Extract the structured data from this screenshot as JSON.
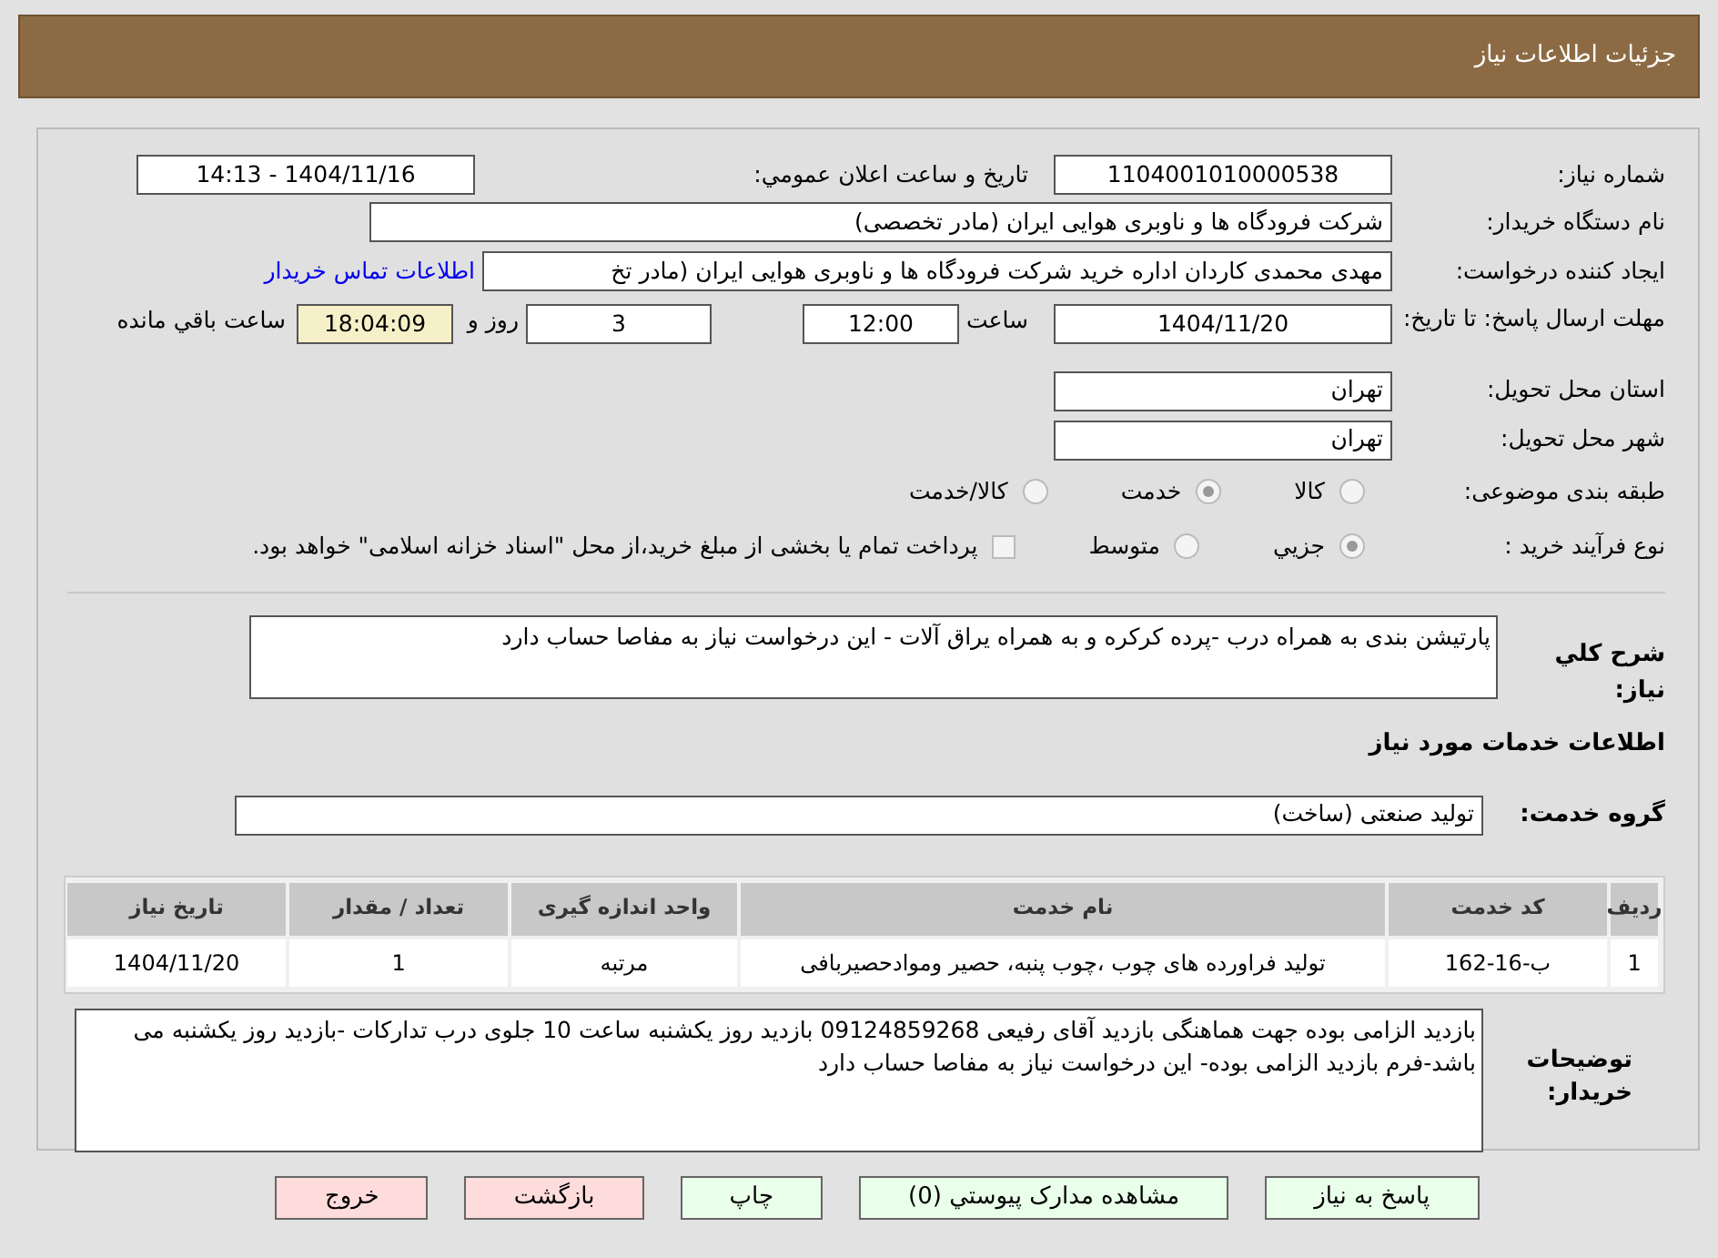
{
  "header": {
    "title": "جزئیات اطلاعات نیاز"
  },
  "need_number": {
    "label": "شماره نیاز:",
    "value": "1104001010000538"
  },
  "announce": {
    "label": "تاريخ و ساعت اعلان عمومي:",
    "value": "1404/11/16 - 14:13"
  },
  "buyer_org": {
    "label": "نام دستگاه خریدار:",
    "value": "شرکت فرودگاه ها و ناوبری هوایی ایران (مادر تخصصی)"
  },
  "requester": {
    "label": "ایجاد کننده درخواست:",
    "value": "مهدی محمدی کاردان اداره خرید شرکت فرودگاه ها و ناوبری هوایی ایران (مادر تخ",
    "contact_link": "اطلاعات تماس خریدار"
  },
  "deadline": {
    "label": "مهلت ارسال پاسخ: تا تاریخ:",
    "date": "1404/11/20",
    "time_label": "ساعت",
    "time": "12:00",
    "days": "3",
    "days_label": "روز و",
    "remaining": "18:04:09",
    "remaining_label": "ساعت باقي مانده"
  },
  "province": {
    "label": "استان محل تحویل:",
    "value": "تهران"
  },
  "city": {
    "label": "شهر محل تحویل:",
    "value": "تهران"
  },
  "category": {
    "label": "طبقه بندی موضوعی:",
    "options": [
      {
        "label": "کالا",
        "selected": false
      },
      {
        "label": "خدمت",
        "selected": true
      },
      {
        "label": "کالا/خدمت",
        "selected": false
      }
    ]
  },
  "process": {
    "label": "نوع فرآیند خرید :",
    "options": [
      {
        "label": "جزيي",
        "selected": true
      },
      {
        "label": "متوسط",
        "selected": false
      }
    ],
    "treasury": {
      "checked": false,
      "label": "پرداخت تمام یا بخشی از مبلغ خرید،از محل \"اسناد خزانه اسلامی\" خواهد بود."
    }
  },
  "description": {
    "label": "شرح كلي نياز:",
    "value": "پارتیشن بندی به همراه درب -پرده کرکره و به همراه یراق آلات - این درخواست نیاز به مفاصا حساب دارد"
  },
  "services_heading": "اطلاعات خدمات مورد نياز",
  "service_group": {
    "label": "گروه خدمت:",
    "value": "تولید صنعتی (ساخت)"
  },
  "table": {
    "columns": [
      "رديف",
      "کد خدمت",
      "نام خدمت",
      "واحد اندازه گیری",
      "تعداد / مقدار",
      "تاریخ نیاز"
    ],
    "rows": [
      [
        "1",
        "ب-16-162",
        "تولید فراورده های چوب ،چوب پنبه، حصیر وموادحصیربافی",
        "مرتبه",
        "1",
        "1404/11/20"
      ]
    ]
  },
  "buyer_notes": {
    "label": "توضیحات خریدار:",
    "value": "بازدید الزامی بوده جهت هماهنگی بازدید آقای رفیعی 09124859268  بازدید روز یکشنبه ساعت 10 جلوی درب تدارکات -بازدید روز یکشنبه می باشد-فرم بازدید الزامی بوده- این درخواست نیاز به مفاصا حساب دارد"
  },
  "buttons": [
    {
      "label": "پاسخ به نیاز",
      "kind": "green"
    },
    {
      "label": "مشاهده مدارک پیوستي (0)",
      "kind": "green"
    },
    {
      "label": "چاپ",
      "kind": "green"
    },
    {
      "label": "بازگشت",
      "kind": "red"
    },
    {
      "label": "خروج",
      "kind": "red"
    }
  ]
}
